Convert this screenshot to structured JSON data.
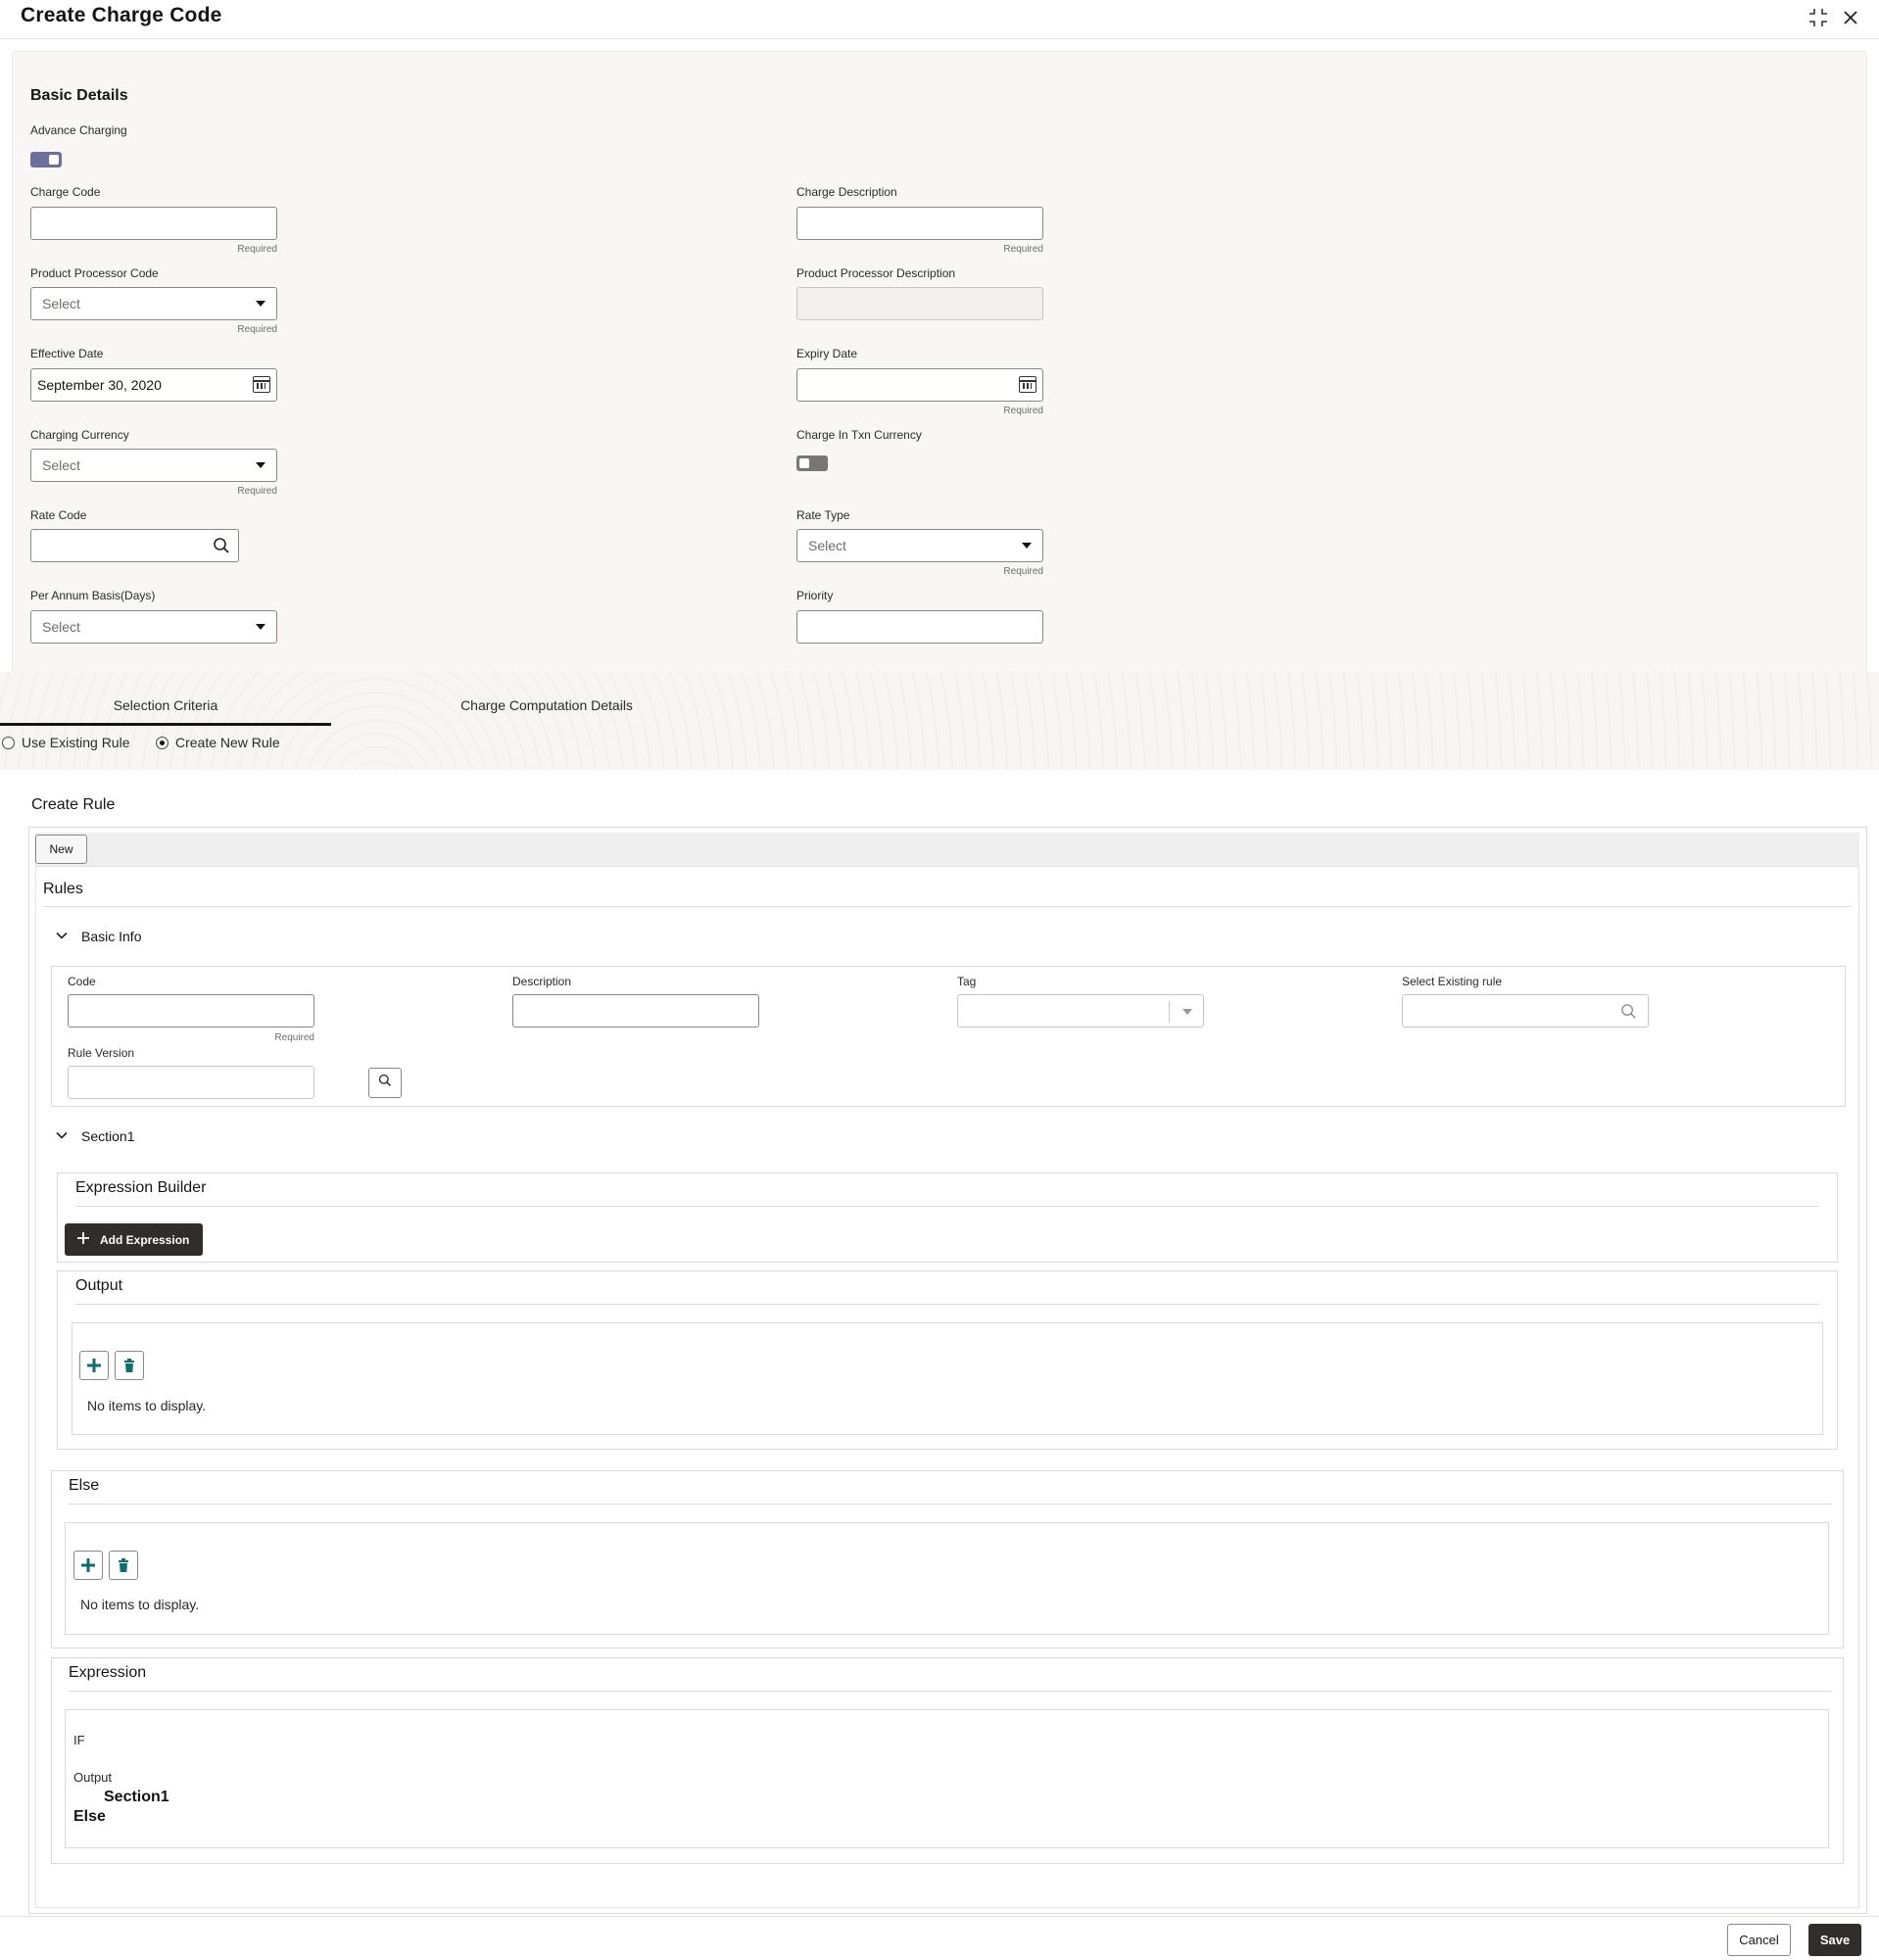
{
  "header": {
    "title": "Create Charge Code",
    "minimize_icon": "collapse-icon",
    "close_icon": "close-icon"
  },
  "basic_details": {
    "title": "Basic Details",
    "advance_charging": {
      "label": "Advance Charging",
      "on": true
    },
    "charge_code": {
      "label": "Charge Code",
      "value": "",
      "hint": "Required"
    },
    "charge_description": {
      "label": "Charge Description",
      "value": "",
      "hint": "Required"
    },
    "product_processor_code": {
      "label": "Product Processor Code",
      "value": "Select",
      "hint": "Required"
    },
    "product_processor_description": {
      "label": "Product Processor Description",
      "value": ""
    },
    "effective_date": {
      "label": "Effective Date",
      "value": "September 30, 2020"
    },
    "expiry_date": {
      "label": "Expiry Date",
      "value": "",
      "hint": "Required"
    },
    "charging_currency": {
      "label": "Charging Currency",
      "value": "Select",
      "hint": "Required"
    },
    "charge_in_txn_currency": {
      "label": "Charge In Txn Currency",
      "on": false
    },
    "rate_code": {
      "label": "Rate Code",
      "value": ""
    },
    "rate_type": {
      "label": "Rate Type",
      "value": "Select",
      "hint": "Required"
    },
    "per_annum_basis": {
      "label": "Per Annum Basis(Days)",
      "value": "Select"
    },
    "priority": {
      "label": "Priority",
      "value": ""
    }
  },
  "tabs": [
    {
      "label": "Selection Criteria",
      "active": true
    },
    {
      "label": "Charge Computation Details",
      "active": false
    }
  ],
  "rule_mode": {
    "options": [
      {
        "label": "Use Existing Rule",
        "selected": false
      },
      {
        "label": "Create New Rule",
        "selected": true
      }
    ]
  },
  "create_rule": {
    "title": "Create Rule",
    "new_button": "New",
    "rules_title": "Rules",
    "basic_info": {
      "title": "Basic Info",
      "code": {
        "label": "Code",
        "value": "",
        "hint": "Required"
      },
      "description": {
        "label": "Description",
        "value": ""
      },
      "tag": {
        "label": "Tag",
        "value": ""
      },
      "select_existing_rule": {
        "label": "Select Existing rule",
        "value": ""
      },
      "rule_version": {
        "label": "Rule Version",
        "value": ""
      }
    },
    "section1": {
      "title": "Section1",
      "expression_builder": {
        "title": "Expression Builder",
        "add_button": "Add Expression"
      },
      "output": {
        "title": "Output",
        "empty": "No items to display."
      }
    },
    "else": {
      "title": "Else",
      "empty": "No items to display."
    },
    "expression": {
      "title": "Expression",
      "if_label": "IF",
      "output_label": "Output",
      "section_label": "Section1",
      "else_label": "Else"
    }
  },
  "footer": {
    "cancel": "Cancel",
    "save": "Save"
  },
  "colors": {
    "accent": "#0f6e6a",
    "primary_dark": "#312d2a",
    "toggle_on": "#6b6f9a",
    "toggle_off": "#7a7671"
  }
}
